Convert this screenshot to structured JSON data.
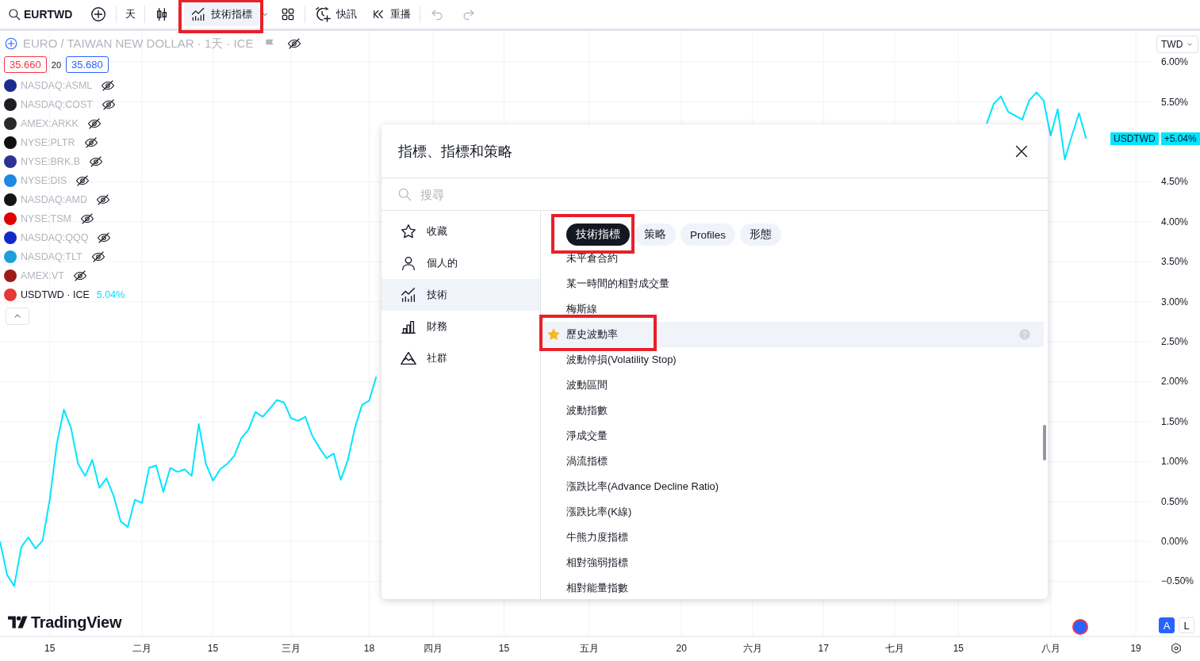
{
  "toolbar": {
    "symbol": "EURTWD",
    "interval": "天",
    "indicators_button": {
      "label": "技術指標",
      "highlighted": true
    },
    "alert_button": {
      "label": "快訊"
    },
    "replay_button": {
      "label": "重播"
    },
    "undo": {
      "disabled": true
    },
    "redo": {
      "disabled": true
    }
  },
  "legend": {
    "title": "EURO / TAIWAN NEW DOLLAR · 1天 · ICE",
    "bid": "35.660",
    "spread": "20",
    "ask": "35.680",
    "symbols": [
      {
        "name": "NASDAQ:ASML",
        "hidden": true,
        "color": "#1c2b8f"
      },
      {
        "name": "NASDAQ:COST",
        "hidden": true,
        "color": "#1e1e24"
      },
      {
        "name": "AMEX:ARKK",
        "hidden": true,
        "color": "#2a2a2e"
      },
      {
        "name": "NYSE:PLTR",
        "hidden": true,
        "color": "#101014"
      },
      {
        "name": "NYSE:BRK.B",
        "hidden": true,
        "color": "#2e3192"
      },
      {
        "name": "NYSE:DIS",
        "hidden": true,
        "color": "#1e88e5"
      },
      {
        "name": "NASDAQ:AMD",
        "hidden": true,
        "color": "#141414"
      },
      {
        "name": "NYSE:TSM",
        "hidden": true,
        "color": "#e00000"
      },
      {
        "name": "NASDAQ:QQQ",
        "hidden": true,
        "color": "#1428c8"
      },
      {
        "name": "NASDAQ:TLT",
        "hidden": true,
        "color": "#1e9fd8"
      },
      {
        "name": "AMEX:VT",
        "hidden": true,
        "color": "#9b1b1b"
      },
      {
        "name": "USDTWD · ICE",
        "hidden": false,
        "color": "#e53935",
        "change": "5.04%"
      }
    ]
  },
  "price_axis": {
    "currency": "TWD"
  },
  "price_tag": {
    "change": "+5.04%"
  },
  "chart_data": {
    "type": "line",
    "categories": [
      null,
      null,
      null,
      null,
      null,
      null,
      null,
      "15",
      null,
      null,
      null,
      null,
      null,
      null,
      null,
      null,
      null,
      null,
      null,
      null,
      "二月",
      null,
      null,
      null,
      null,
      null,
      null,
      null,
      null,
      null,
      "15",
      null,
      null,
      null,
      null,
      null,
      null,
      null,
      null,
      null,
      null,
      "三月",
      null,
      null,
      null,
      null,
      null,
      null,
      null,
      null,
      null,
      null,
      "18",
      null,
      null,
      null,
      null,
      null,
      null,
      null,
      null,
      "四月",
      null,
      null,
      null,
      null,
      null,
      null,
      null,
      null,
      null,
      "15",
      null,
      null,
      null,
      null,
      null,
      null,
      null,
      null,
      null,
      null,
      null,
      "五月",
      null,
      null,
      null,
      null,
      null,
      null,
      null,
      null,
      null,
      null,
      null,
      null,
      "20",
      null,
      null,
      null,
      null,
      null,
      null,
      null,
      null,
      null,
      "六月",
      null,
      null,
      null,
      null,
      null,
      null,
      null,
      null,
      null,
      "17",
      null,
      null,
      null,
      null,
      null,
      null,
      null,
      null,
      null,
      "七月",
      null,
      null,
      null,
      null,
      null,
      null,
      null,
      null,
      "15",
      null,
      null,
      null,
      null,
      null,
      null,
      null,
      null,
      null,
      null,
      null,
      null,
      "八月",
      null,
      null,
      null,
      null,
      null,
      null,
      null,
      null,
      null,
      null,
      null,
      "19",
      null
    ],
    "series": [
      {
        "name": "USDTWD",
        "color": "#00e5ff",
        "values": [
          0.0,
          -0.42,
          -0.56,
          -0.07,
          0.05,
          -0.09,
          0.01,
          0.52,
          1.22,
          1.65,
          1.42,
          0.97,
          0.82,
          1.02,
          0.67,
          0.79,
          0.57,
          0.25,
          0.18,
          0.52,
          0.48,
          0.92,
          0.95,
          0.62,
          0.92,
          0.87,
          0.9,
          0.82,
          1.47,
          0.97,
          0.76,
          0.9,
          0.97,
          1.07,
          1.29,
          1.4,
          1.62,
          1.56,
          1.66,
          1.77,
          1.74,
          1.54,
          1.51,
          1.56,
          1.32,
          1.17,
          1.04,
          1.1,
          0.77,
          1.02,
          1.42,
          1.71,
          1.76,
          2.06,
          null,
          null,
          null,
          null,
          null,
          null,
          null,
          null,
          null,
          null,
          null,
          null,
          null,
          null,
          null,
          null,
          null,
          null,
          null,
          null,
          null,
          null,
          null,
          null,
          null,
          null,
          null,
          null,
          null,
          null,
          null,
          null,
          null,
          null,
          null,
          null,
          null,
          null,
          null,
          null,
          null,
          null,
          null,
          null,
          null,
          null,
          null,
          null,
          null,
          null,
          null,
          null,
          null,
          null,
          null,
          null,
          null,
          null,
          null,
          null,
          null,
          null,
          null,
          null,
          null,
          null,
          null,
          null,
          null,
          null,
          null,
          null,
          null,
          null,
          null,
          null,
          null,
          null,
          null,
          null,
          null,
          null,
          null,
          null,
          null,
          5.23,
          5.48,
          5.57,
          5.38,
          5.33,
          5.28,
          5.52,
          5.62,
          5.52,
          5.08,
          5.41,
          4.78,
          5.08,
          5.36,
          5.04,
          null,
          null,
          null,
          null,
          null,
          null,
          null,
          null
        ]
      }
    ],
    "ylim": [
      -1.19,
      6.39
    ],
    "grid": true,
    "yticks": [
      {
        "value": 6,
        "label": "6.00%"
      },
      {
        "value": 5.5,
        "label": "5.50%"
      },
      {
        "value": 4.5,
        "label": "4.50%"
      },
      {
        "value": 4,
        "label": "4.00%"
      },
      {
        "value": 3.5,
        "label": "3.50%"
      },
      {
        "value": 3,
        "label": "3.00%"
      },
      {
        "value": 2.5,
        "label": "2.50%"
      },
      {
        "value": 2,
        "label": "2.00%"
      },
      {
        "value": 1.5,
        "label": "1.50%"
      },
      {
        "value": 1,
        "label": "1.00%"
      },
      {
        "value": 0.5,
        "label": "0.50%"
      },
      {
        "value": 0,
        "label": "0.00%"
      },
      {
        "value": -0.5,
        "label": "−0.50%"
      }
    ]
  },
  "bottom": {
    "logo": "TradingView",
    "auto_button": {
      "label": "A",
      "selected": true
    },
    "log_button": {
      "label": "L",
      "selected": false
    }
  },
  "dialog": {
    "title": "指標、指標和策略",
    "search": {
      "placeholder": "搜尋"
    },
    "nav": [
      {
        "kind": "favorites",
        "label": "收藏",
        "selected": false
      },
      {
        "kind": "personal",
        "label": "個人的",
        "selected": false
      },
      {
        "kind": "technicals",
        "label": "技術",
        "selected": true
      },
      {
        "kind": "financials",
        "label": "財務",
        "selected": false
      },
      {
        "kind": "community",
        "label": "社群",
        "selected": false
      }
    ],
    "chips": [
      {
        "label": "技術指標",
        "selected": true,
        "highlighted": true
      },
      {
        "label": "策略",
        "selected": false,
        "highlighted": false
      },
      {
        "label": "Profiles",
        "selected": false,
        "highlighted": false
      },
      {
        "label": "形態",
        "selected": false,
        "highlighted": false
      }
    ],
    "items": [
      {
        "label": "未平倉合約",
        "selected": false,
        "favorite": false,
        "highlighted": false
      },
      {
        "label": "某一時間的相對成交量",
        "selected": false,
        "favorite": false,
        "highlighted": false
      },
      {
        "label": "梅斯線",
        "selected": false,
        "favorite": false,
        "highlighted": false
      },
      {
        "label": "歷史波動率",
        "selected": true,
        "favorite": true,
        "highlighted": true
      },
      {
        "label": "波動停損(Volatility Stop)",
        "selected": false,
        "favorite": false,
        "highlighted": false
      },
      {
        "label": "波動區間",
        "selected": false,
        "favorite": false,
        "highlighted": false
      },
      {
        "label": "波動指數",
        "selected": false,
        "favorite": false,
        "highlighted": false
      },
      {
        "label": "淨成交量",
        "selected": false,
        "favorite": false,
        "highlighted": false
      },
      {
        "label": "渦流指標",
        "selected": false,
        "favorite": false,
        "highlighted": false
      },
      {
        "label": "漲跌比率(Advance Decline Ratio)",
        "selected": false,
        "favorite": false,
        "highlighted": false
      },
      {
        "label": "漲跌比率(K線)",
        "selected": false,
        "favorite": false,
        "highlighted": false
      },
      {
        "label": "牛熊力度指標",
        "selected": false,
        "favorite": false,
        "highlighted": false
      },
      {
        "label": "相對強弱指標",
        "selected": false,
        "favorite": false,
        "highlighted": false
      },
      {
        "label": "相對能量指數",
        "selected": false,
        "favorite": false,
        "highlighted": false
      }
    ]
  }
}
